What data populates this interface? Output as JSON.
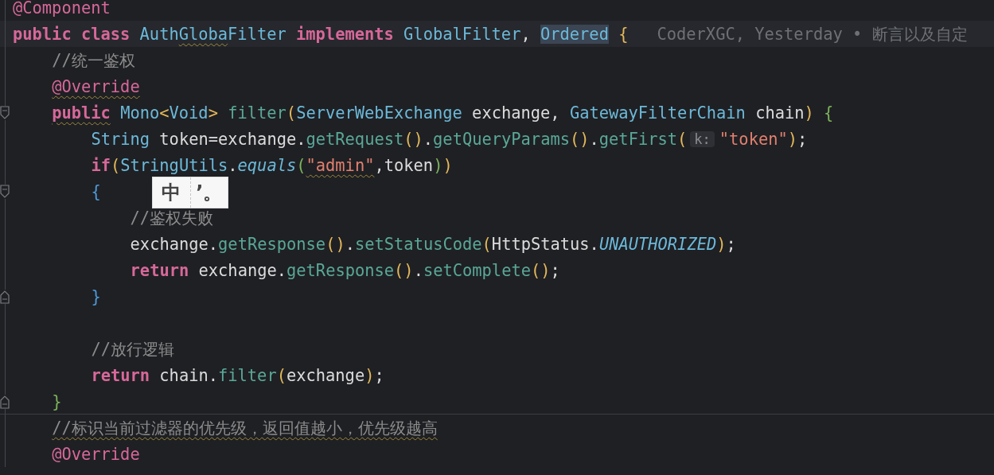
{
  "editor": {
    "lines": [
      {
        "tokens": [
          {
            "text": "@Component",
            "kind": "annotation"
          }
        ]
      },
      {
        "current": true,
        "tokens": [
          {
            "text": "public class ",
            "kind": "keyword"
          },
          {
            "text": "Auth",
            "kind": "class"
          },
          {
            "text": "Globa",
            "kind": "class",
            "squiggle": true
          },
          {
            "text": "Filter",
            "kind": "class"
          },
          {
            "text": " implements ",
            "kind": "keyword"
          },
          {
            "text": "GlobalFilter",
            "kind": "class"
          },
          {
            "text": ", ",
            "kind": "plain"
          },
          {
            "text": "Ordered",
            "kind": "match"
          },
          {
            "text": " {",
            "kind": "paren"
          },
          {
            "text": "CoderXGC, Yesterday • 断言以及自定",
            "kind": "blame"
          }
        ],
        "children": [
          {
            "tokens": [
              {
                "text": "//统一鉴权",
                "kind": "comment"
              }
            ]
          },
          {
            "tokens": [
              {
                "text": "@Override",
                "kind": "annotation",
                "squiggle": true
              }
            ]
          },
          {
            "fold_start": true,
            "tokens": [
              {
                "text": "public",
                "kind": "keyword",
                "squiggle": true
              },
              {
                "text": " Mono",
                "kind": "class"
              },
              {
                "text": "<",
                "kind": "paren"
              },
              {
                "text": "Void",
                "kind": "class"
              },
              {
                "text": ">",
                "kind": "paren"
              },
              {
                "text": " filter",
                "kind": "method"
              },
              {
                "text": "(",
                "kind": "paren"
              },
              {
                "text": "ServerWebExchange",
                "kind": "class"
              },
              {
                "text": " exchange, ",
                "kind": "plain"
              },
              {
                "text": "GatewayFilterChain",
                "kind": "class"
              },
              {
                "text": " chain",
                "kind": "plain"
              },
              {
                "text": ") ",
                "kind": "paren"
              },
              {
                "text": "{",
                "kind": "brace2"
              }
            ],
            "children": [
              {
                "tokens": [
                  {
                    "text": "String",
                    "kind": "class"
                  },
                  {
                    "text": " token=exchange.",
                    "kind": "plain"
                  },
                  {
                    "text": "getRequest",
                    "kind": "method"
                  },
                  {
                    "text": "()",
                    "kind": "paren"
                  },
                  {
                    "text": ".",
                    "kind": "plain"
                  },
                  {
                    "text": "getQueryParams",
                    "kind": "method"
                  },
                  {
                    "text": "()",
                    "kind": "paren"
                  },
                  {
                    "text": ".",
                    "kind": "plain"
                  },
                  {
                    "text": "getFirst",
                    "kind": "method"
                  },
                  {
                    "text": "(",
                    "kind": "paren"
                  },
                  {
                    "text": "k:",
                    "kind": "hint"
                  },
                  {
                    "text": "\"token\"",
                    "kind": "string"
                  },
                  {
                    "text": ")",
                    "kind": "paren"
                  },
                  {
                    "text": ";",
                    "kind": "plain"
                  }
                ]
              },
              {
                "tokens": [
                  {
                    "text": "if",
                    "kind": "keyword"
                  },
                  {
                    "text": "(",
                    "kind": "paren"
                  },
                  {
                    "text": "StringUtils",
                    "kind": "class"
                  },
                  {
                    "text": ".",
                    "kind": "plain"
                  },
                  {
                    "text": "equals",
                    "kind": "static"
                  },
                  {
                    "text": "(",
                    "kind": "brace2"
                  },
                  {
                    "text": "\"admin\"",
                    "kind": "string",
                    "squiggle": true
                  },
                  {
                    "text": ",token",
                    "kind": "plain"
                  },
                  {
                    "text": ")",
                    "kind": "brace2"
                  },
                  {
                    "text": ")",
                    "kind": "paren"
                  }
                ]
              },
              {
                "fold_start": true,
                "tokens": [
                  {
                    "text": "{",
                    "kind": "brace3"
                  }
                ],
                "children": [
                  {
                    "tokens": [
                      {
                        "text": "//鉴权失败",
                        "kind": "comment"
                      }
                    ]
                  },
                  {
                    "tokens": [
                      {
                        "text": "exchange.",
                        "kind": "plain"
                      },
                      {
                        "text": "getResponse",
                        "kind": "method"
                      },
                      {
                        "text": "()",
                        "kind": "paren"
                      },
                      {
                        "text": ".",
                        "kind": "plain"
                      },
                      {
                        "text": "setStatusCode",
                        "kind": "method"
                      },
                      {
                        "text": "(",
                        "kind": "paren"
                      },
                      {
                        "text": "HttpStatus.",
                        "kind": "plain"
                      },
                      {
                        "text": "UNAUTHORIZED",
                        "kind": "static"
                      },
                      {
                        "text": ")",
                        "kind": "paren"
                      },
                      {
                        "text": ";",
                        "kind": "plain"
                      }
                    ]
                  },
                  {
                    "tokens": [
                      {
                        "text": "return",
                        "kind": "keyword"
                      },
                      {
                        "text": " exchange.",
                        "kind": "plain"
                      },
                      {
                        "text": "getResponse",
                        "kind": "method"
                      },
                      {
                        "text": "()",
                        "kind": "paren"
                      },
                      {
                        "text": ".",
                        "kind": "plain"
                      },
                      {
                        "text": "setComplete",
                        "kind": "method"
                      },
                      {
                        "text": "()",
                        "kind": "paren"
                      },
                      {
                        "text": ";",
                        "kind": "plain"
                      }
                    ]
                  }
                ]
              },
              {
                "fold_end": true,
                "tokens": [
                  {
                    "text": "}",
                    "kind": "brace3"
                  }
                ]
              },
              {
                "blank": true
              },
              {
                "tokens": [
                  {
                    "text": "//放行逻辑",
                    "kind": "comment"
                  }
                ]
              },
              {
                "tokens": [
                  {
                    "text": "return",
                    "kind": "keyword"
                  },
                  {
                    "text": " chain.",
                    "kind": "plain"
                  },
                  {
                    "text": "filter",
                    "kind": "method"
                  },
                  {
                    "text": "(",
                    "kind": "paren"
                  },
                  {
                    "text": "exchange",
                    "kind": "plain"
                  },
                  {
                    "text": ")",
                    "kind": "paren"
                  },
                  {
                    "text": ";",
                    "kind": "plain"
                  }
                ]
              }
            ]
          },
          {
            "fold_end": true,
            "tokens": [
              {
                "text": "}",
                "kind": "brace2"
              }
            ]
          },
          {
            "separator": true,
            "tokens": [
              {
                "text": "//标识当前过滤器的优先级，返回值越小，优先级越高",
                "kind": "comment",
                "squiggle": true
              }
            ]
          },
          {
            "tokens": [
              {
                "text": "@Override",
                "kind": "annotation"
              }
            ]
          }
        ]
      }
    ]
  },
  "ime_popup": {
    "mode": "中",
    "punctuation": "’。"
  }
}
